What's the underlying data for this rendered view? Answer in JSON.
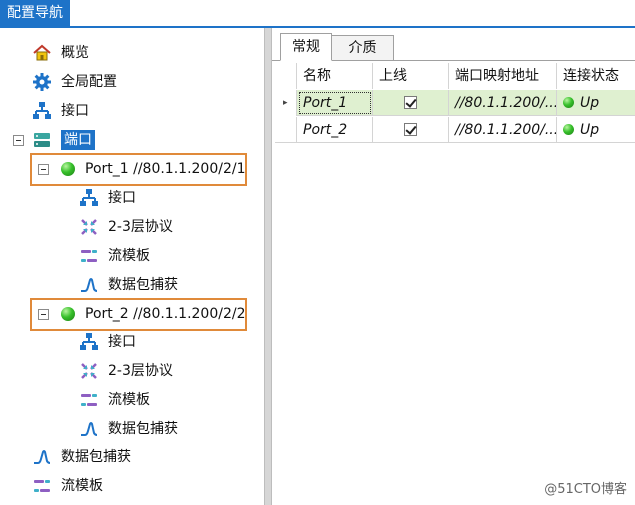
{
  "window": {
    "title": "配置导航"
  },
  "tree": {
    "items": [
      {
        "label": "概览",
        "icon": "home-icon"
      },
      {
        "label": "全局配置",
        "icon": "gear-icon"
      },
      {
        "label": "接口",
        "icon": "network-icon"
      },
      {
        "label": "端口",
        "icon": "switch-icon"
      },
      {
        "label": "Port_1 //80.1.1.200/2/1",
        "icon": "status-led-icon"
      },
      {
        "label": "接口",
        "icon": "network-icon"
      },
      {
        "label": "2-3层协议",
        "icon": "protocol-icon"
      },
      {
        "label": "流模板",
        "icon": "stream-template-icon"
      },
      {
        "label": "数据包捕获",
        "icon": "capture-icon"
      },
      {
        "label": "Port_2 //80.1.1.200/2/2",
        "icon": "status-led-icon"
      },
      {
        "label": "接口",
        "icon": "network-icon"
      },
      {
        "label": "2-3层协议",
        "icon": "protocol-icon"
      },
      {
        "label": "流模板",
        "icon": "stream-template-icon"
      },
      {
        "label": "数据包捕获",
        "icon": "capture-icon"
      },
      {
        "label": "数据包捕获",
        "icon": "capture-icon"
      },
      {
        "label": "流模板",
        "icon": "stream-template-icon"
      }
    ]
  },
  "tabs": [
    {
      "label": "常规"
    },
    {
      "label": "介质"
    }
  ],
  "grid": {
    "columns": [
      "名称",
      "上线",
      "端口映射地址",
      "连接状态"
    ],
    "rows": [
      {
        "name": "Port_1",
        "online": true,
        "address": "//80.1.1.200/...",
        "status": "Up"
      },
      {
        "name": "Port_2",
        "online": true,
        "address": "//80.1.1.200/...",
        "status": "Up"
      }
    ]
  },
  "watermark": "@51CTO博客",
  "colors": {
    "accent": "#1e73c8",
    "highlight_box": "#e08a3a",
    "selected_row": "#dff0d0",
    "status_up": "#37c02b"
  }
}
